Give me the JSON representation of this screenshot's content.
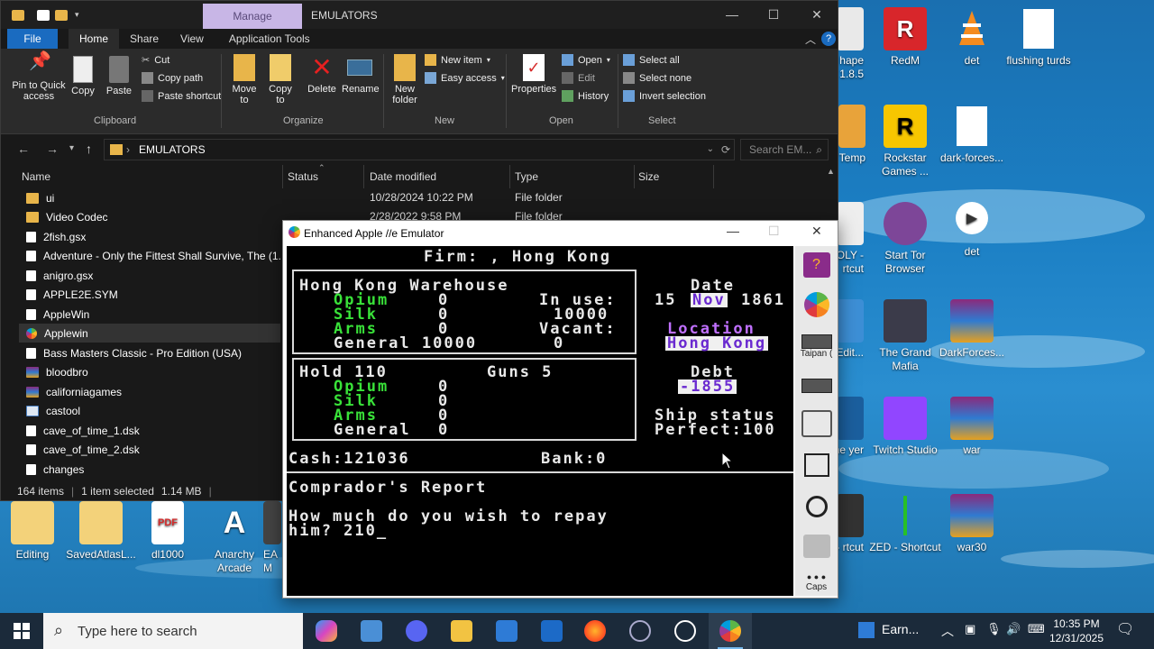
{
  "desktop": {
    "icons": [
      {
        "label": "hape\n1.8.5",
        "icon": "app-icon"
      },
      {
        "label": "RedM",
        "icon": "redm-icon"
      },
      {
        "label": "det",
        "icon": "vlc-icon"
      },
      {
        "label": "flushing turds",
        "icon": "file-icon"
      },
      {
        "label": "Temp",
        "icon": "folder-icon"
      },
      {
        "label": "Rockstar Games ...",
        "icon": "rockstar-icon"
      },
      {
        "label": "dark-forces...",
        "icon": "file-icon"
      },
      {
        "label": "POLY - rtcut",
        "icon": "app-icon"
      },
      {
        "label": "Start Tor Browser",
        "icon": "tor-icon"
      },
      {
        "label": "det",
        "icon": "video-icon"
      },
      {
        "label": "avi Edit...",
        "icon": "app-icon"
      },
      {
        "label": "The Grand Mafia",
        "icon": "game-icon"
      },
      {
        "label": "DarkForces...",
        "icon": "winrar-icon"
      },
      {
        "label": "Time yer",
        "icon": "app-icon"
      },
      {
        "label": "Twitch Studio",
        "icon": "twitch-icon"
      },
      {
        "label": "war",
        "icon": "winrar-icon"
      },
      {
        "label": "oads - rtcut",
        "icon": "app-icon"
      },
      {
        "label": "ZED - Shortcut",
        "icon": "zed-icon"
      },
      {
        "label": "war30",
        "icon": "winrar-icon"
      },
      {
        "label": "Editing",
        "icon": "folder-icon"
      },
      {
        "label": "SavedAtlasL...",
        "icon": "folder-icon"
      },
      {
        "label": "dl1000",
        "icon": "pdf-icon"
      },
      {
        "label": "Anarchy Arcade",
        "icon": "anarchy-icon"
      },
      {
        "label": "EA M",
        "icon": "app-icon"
      }
    ]
  },
  "explorer": {
    "title": "EMULATORS",
    "manage_tab": "Manage",
    "tabs": [
      "File",
      "Home",
      "Share",
      "View",
      "Application Tools"
    ],
    "ribbon": {
      "pin": "Pin to Quick access",
      "copy": "Copy",
      "paste": "Paste",
      "cut": "Cut",
      "copy_path": "Copy path",
      "paste_shortcut": "Paste shortcut",
      "move_to": "Move to",
      "copy_to": "Copy to",
      "delete": "Delete",
      "rename": "Rename",
      "new_folder": "New folder",
      "new_item": "New item",
      "easy_access": "Easy access",
      "properties": "Properties",
      "open": "Open",
      "edit": "Edit",
      "history": "History",
      "select_all": "Select all",
      "select_none": "Select none",
      "invert_selection": "Invert selection",
      "groups": [
        "Clipboard",
        "Organize",
        "New",
        "Open",
        "Select"
      ]
    },
    "address": "EMULATORS",
    "search_placeholder": "Search EM...",
    "columns": [
      "Name",
      "Status",
      "Date modified",
      "Type",
      "Size"
    ],
    "files": [
      {
        "name": "ui",
        "date": "10/28/2024 10:22 PM",
        "type": "File folder",
        "icon": "folder-icon"
      },
      {
        "name": "Video Codec",
        "date": "2/28/2022 9:58 PM",
        "type": "File folder",
        "icon": "folder-icon"
      },
      {
        "name": "2fish.gsx",
        "icon": "file-icon"
      },
      {
        "name": "Adventure - Only the Fittest Shall Survive, The (1...",
        "icon": "file-icon"
      },
      {
        "name": "anigro.gsx",
        "icon": "file-icon"
      },
      {
        "name": "APPLE2E.SYM",
        "icon": "file-icon"
      },
      {
        "name": "AppleWin",
        "icon": "applewin-icon"
      },
      {
        "name": "Applewin",
        "icon": "applewin-icon"
      },
      {
        "name": "Bass Masters Classic - Pro Edition (USA)",
        "icon": "file-icon"
      },
      {
        "name": "bloodbro",
        "icon": "winrar-icon"
      },
      {
        "name": "californiagames",
        "icon": "winrar-icon"
      },
      {
        "name": "castool",
        "icon": "exe-icon"
      },
      {
        "name": "cave_of_time_1.dsk",
        "icon": "file-icon"
      },
      {
        "name": "cave_of_time_2.dsk",
        "icon": "file-icon"
      },
      {
        "name": "changes",
        "icon": "file-icon"
      }
    ],
    "status": {
      "count": "164 items",
      "selected": "1 item selected",
      "size": "1.14 MB"
    }
  },
  "emulator": {
    "title": "Enhanced Apple //e Emulator",
    "screen": {
      "firm": "Firm: , Hong Kong",
      "warehouse_title": "Hong Kong Warehouse",
      "in_use_label": "In use:",
      "in_use": "10000",
      "vacant_label": "Vacant:",
      "vacant": "0",
      "w_opium": "Opium",
      "w_opium_v": "0",
      "w_silk": "Silk",
      "w_silk_v": "0",
      "w_arms": "Arms",
      "w_arms_v": "0",
      "w_general": "General 10000",
      "hold_label": "Hold 110",
      "guns_label": "Guns 5",
      "h_opium": "Opium",
      "h_opium_v": "0",
      "h_silk": "Silk",
      "h_silk_v": "0",
      "h_arms": "Arms",
      "h_arms_v": "0",
      "h_general": "General",
      "h_general_v": "0",
      "date_label": "Date",
      "date_day": "15",
      "date_month": "Nov",
      "date_year": "1861",
      "location_label": "Location",
      "location": "Hong Kong",
      "debt_label": "Debt",
      "debt": "-1855",
      "ship_status_label": "Ship status",
      "ship_status": "Perfect:100",
      "cash": "Cash:121036",
      "bank": "Bank:0",
      "report_title": "Comprador's Report",
      "question_1": "How much do you wish to repay",
      "question_2": "him? 210_"
    },
    "side_labels": {
      "taipan": "Taipan (",
      "caps": "Caps"
    }
  },
  "taskbar": {
    "search_placeholder": "Type here to search",
    "weather": "Earn...",
    "time": "10:35 PM",
    "date": "12/31/2025"
  }
}
